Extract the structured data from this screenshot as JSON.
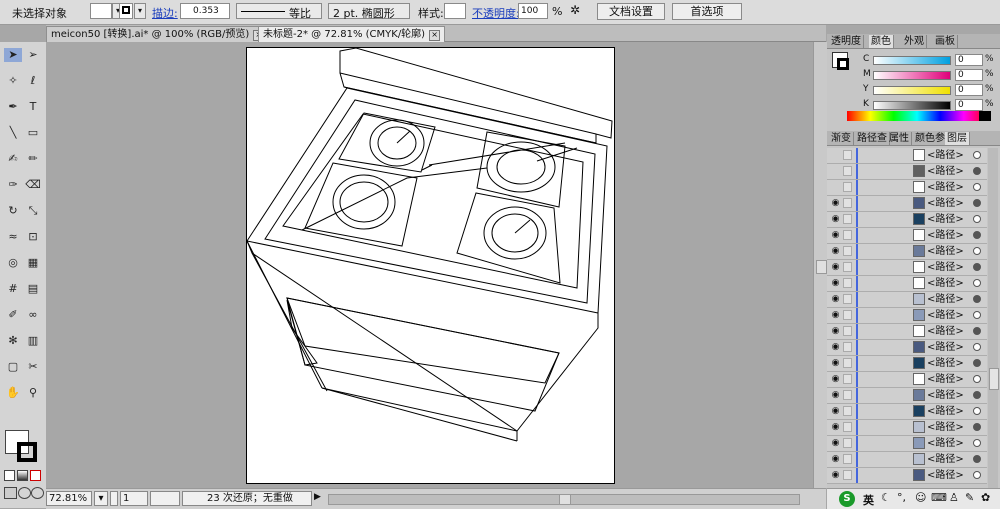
{
  "control_bar": {
    "selection": "未选择对象",
    "stroke_label": "描边:",
    "stroke_weight": "0.353",
    "stroke_profile": "等比",
    "brush": "2 pt. 椭圆形",
    "style_label": "样式:",
    "opacity_label": "不透明度:",
    "opacity_value": "100",
    "opacity_unit": "%",
    "doc_setup_button": "文档设置",
    "preferences_button": "首选项"
  },
  "doc_tabs": [
    {
      "label": "meicon50 [转换].ai* @ 100% (RGB/预览)"
    },
    {
      "label": "未标题-2* @ 72.81% (CMYK/轮廓)"
    }
  ],
  "tool_icons": [
    "selection-icon",
    "direct-selection-icon",
    "magic-wand-icon",
    "lasso-icon",
    "pen-icon",
    "type-icon",
    "line-icon",
    "rectangle-icon",
    "paintbrush-icon",
    "pencil-icon",
    "blob-brush-icon",
    "eraser-icon",
    "rotate-icon",
    "scale-icon",
    "warp-icon",
    "free-transform-icon",
    "shape-builder-icon",
    "perspective-grid-icon",
    "mesh-icon",
    "gradient-icon",
    "eyedropper-icon",
    "blend-icon",
    "symbol-sprayer-icon",
    "column-graph-icon",
    "artboard-icon",
    "slice-icon",
    "hand-icon",
    "zoom-icon"
  ],
  "status_bar": {
    "zoom": "72.81%",
    "artboard_number": "1",
    "history": "23 次还原；无重做"
  },
  "color_panel": {
    "tabs": [
      "透明度",
      "颜色",
      "外观",
      "画板"
    ],
    "active_tab": "颜色",
    "channels": [
      {
        "label": "C",
        "value": "0",
        "color": "#00a0e0"
      },
      {
        "label": "M",
        "value": "0",
        "color": "#e0007a"
      },
      {
        "label": "Y",
        "value": "0",
        "color": "#f0e000"
      },
      {
        "label": "K",
        "value": "0",
        "color": "#000000"
      }
    ]
  },
  "layers_panel": {
    "tabs": [
      "渐变",
      "路径查",
      "属性",
      "颜色参",
      "图层"
    ],
    "active_tab": "图层",
    "rows": [
      {
        "name": "<路径>",
        "visible": false,
        "fill": "#ffffff"
      },
      {
        "name": "<路径>",
        "visible": false,
        "fill": "#606060"
      },
      {
        "name": "<路径>",
        "visible": false,
        "fill": "#ffffff"
      },
      {
        "name": "<路径>",
        "visible": true,
        "fill": "#4a5a80"
      },
      {
        "name": "<路径>",
        "visible": true,
        "fill": "#1a4060"
      },
      {
        "name": "<路径>",
        "visible": true,
        "fill": "#ffffff"
      },
      {
        "name": "<路径>",
        "visible": true,
        "fill": "#6a7a9a"
      },
      {
        "name": "<路径>",
        "visible": true,
        "fill": "#ffffff"
      },
      {
        "name": "<路径>",
        "visible": true,
        "fill": "#ffffff"
      },
      {
        "name": "<路径>",
        "visible": true,
        "fill": "#b8c0d0"
      },
      {
        "name": "<路径>",
        "visible": true,
        "fill": "#8a9ab8"
      },
      {
        "name": "<路径>",
        "visible": true,
        "fill": "#ffffff"
      },
      {
        "name": "<路径>",
        "visible": true,
        "fill": "#4a5a80"
      },
      {
        "name": "<路径>",
        "visible": true,
        "fill": "#1a4060"
      },
      {
        "name": "<路径>",
        "visible": true,
        "fill": "#ffffff"
      },
      {
        "name": "<路径>",
        "visible": true,
        "fill": "#6a7a9a"
      },
      {
        "name": "<路径>",
        "visible": true,
        "fill": "#1a4060"
      },
      {
        "name": "<路径>",
        "visible": true,
        "fill": "#b8c0d0"
      },
      {
        "name": "<路径>",
        "visible": true,
        "fill": "#8a9ab8"
      },
      {
        "name": "<路径>",
        "visible": true,
        "fill": "#b8c0d0"
      },
      {
        "name": "<路径>",
        "visible": true,
        "fill": "#4a5a80"
      }
    ]
  },
  "taskbar": {
    "ime": "英"
  }
}
